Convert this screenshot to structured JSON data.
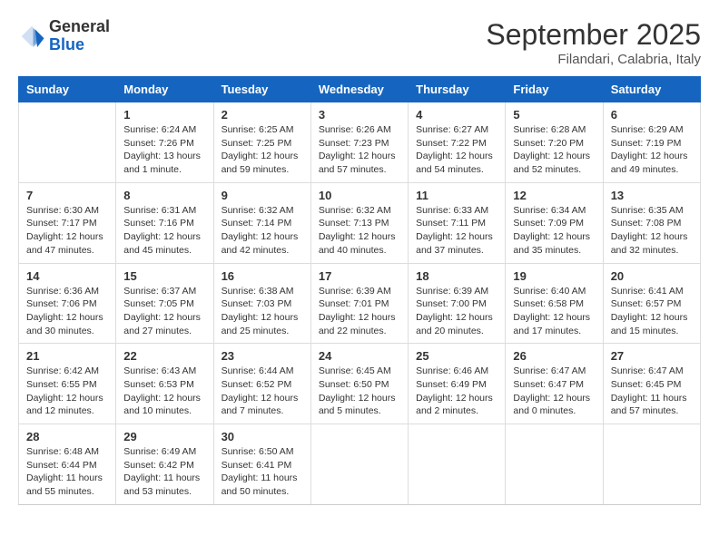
{
  "header": {
    "logo": {
      "general": "General",
      "blue": "Blue"
    },
    "title": "September 2025",
    "location": "Filandari, Calabria, Italy"
  },
  "days_of_week": [
    "Sunday",
    "Monday",
    "Tuesday",
    "Wednesday",
    "Thursday",
    "Friday",
    "Saturday"
  ],
  "weeks": [
    [
      {
        "day": "",
        "content": ""
      },
      {
        "day": "1",
        "content": "Sunrise: 6:24 AM\nSunset: 7:26 PM\nDaylight: 13 hours\nand 1 minute."
      },
      {
        "day": "2",
        "content": "Sunrise: 6:25 AM\nSunset: 7:25 PM\nDaylight: 12 hours\nand 59 minutes."
      },
      {
        "day": "3",
        "content": "Sunrise: 6:26 AM\nSunset: 7:23 PM\nDaylight: 12 hours\nand 57 minutes."
      },
      {
        "day": "4",
        "content": "Sunrise: 6:27 AM\nSunset: 7:22 PM\nDaylight: 12 hours\nand 54 minutes."
      },
      {
        "day": "5",
        "content": "Sunrise: 6:28 AM\nSunset: 7:20 PM\nDaylight: 12 hours\nand 52 minutes."
      },
      {
        "day": "6",
        "content": "Sunrise: 6:29 AM\nSunset: 7:19 PM\nDaylight: 12 hours\nand 49 minutes."
      }
    ],
    [
      {
        "day": "7",
        "content": "Sunrise: 6:30 AM\nSunset: 7:17 PM\nDaylight: 12 hours\nand 47 minutes."
      },
      {
        "day": "8",
        "content": "Sunrise: 6:31 AM\nSunset: 7:16 PM\nDaylight: 12 hours\nand 45 minutes."
      },
      {
        "day": "9",
        "content": "Sunrise: 6:32 AM\nSunset: 7:14 PM\nDaylight: 12 hours\nand 42 minutes."
      },
      {
        "day": "10",
        "content": "Sunrise: 6:32 AM\nSunset: 7:13 PM\nDaylight: 12 hours\nand 40 minutes."
      },
      {
        "day": "11",
        "content": "Sunrise: 6:33 AM\nSunset: 7:11 PM\nDaylight: 12 hours\nand 37 minutes."
      },
      {
        "day": "12",
        "content": "Sunrise: 6:34 AM\nSunset: 7:09 PM\nDaylight: 12 hours\nand 35 minutes."
      },
      {
        "day": "13",
        "content": "Sunrise: 6:35 AM\nSunset: 7:08 PM\nDaylight: 12 hours\nand 32 minutes."
      }
    ],
    [
      {
        "day": "14",
        "content": "Sunrise: 6:36 AM\nSunset: 7:06 PM\nDaylight: 12 hours\nand 30 minutes."
      },
      {
        "day": "15",
        "content": "Sunrise: 6:37 AM\nSunset: 7:05 PM\nDaylight: 12 hours\nand 27 minutes."
      },
      {
        "day": "16",
        "content": "Sunrise: 6:38 AM\nSunset: 7:03 PM\nDaylight: 12 hours\nand 25 minutes."
      },
      {
        "day": "17",
        "content": "Sunrise: 6:39 AM\nSunset: 7:01 PM\nDaylight: 12 hours\nand 22 minutes."
      },
      {
        "day": "18",
        "content": "Sunrise: 6:39 AM\nSunset: 7:00 PM\nDaylight: 12 hours\nand 20 minutes."
      },
      {
        "day": "19",
        "content": "Sunrise: 6:40 AM\nSunset: 6:58 PM\nDaylight: 12 hours\nand 17 minutes."
      },
      {
        "day": "20",
        "content": "Sunrise: 6:41 AM\nSunset: 6:57 PM\nDaylight: 12 hours\nand 15 minutes."
      }
    ],
    [
      {
        "day": "21",
        "content": "Sunrise: 6:42 AM\nSunset: 6:55 PM\nDaylight: 12 hours\nand 12 minutes."
      },
      {
        "day": "22",
        "content": "Sunrise: 6:43 AM\nSunset: 6:53 PM\nDaylight: 12 hours\nand 10 minutes."
      },
      {
        "day": "23",
        "content": "Sunrise: 6:44 AM\nSunset: 6:52 PM\nDaylight: 12 hours\nand 7 minutes."
      },
      {
        "day": "24",
        "content": "Sunrise: 6:45 AM\nSunset: 6:50 PM\nDaylight: 12 hours\nand 5 minutes."
      },
      {
        "day": "25",
        "content": "Sunrise: 6:46 AM\nSunset: 6:49 PM\nDaylight: 12 hours\nand 2 minutes."
      },
      {
        "day": "26",
        "content": "Sunrise: 6:47 AM\nSunset: 6:47 PM\nDaylight: 12 hours\nand 0 minutes."
      },
      {
        "day": "27",
        "content": "Sunrise: 6:47 AM\nSunset: 6:45 PM\nDaylight: 11 hours\nand 57 minutes."
      }
    ],
    [
      {
        "day": "28",
        "content": "Sunrise: 6:48 AM\nSunset: 6:44 PM\nDaylight: 11 hours\nand 55 minutes."
      },
      {
        "day": "29",
        "content": "Sunrise: 6:49 AM\nSunset: 6:42 PM\nDaylight: 11 hours\nand 53 minutes."
      },
      {
        "day": "30",
        "content": "Sunrise: 6:50 AM\nSunset: 6:41 PM\nDaylight: 11 hours\nand 50 minutes."
      },
      {
        "day": "",
        "content": ""
      },
      {
        "day": "",
        "content": ""
      },
      {
        "day": "",
        "content": ""
      },
      {
        "day": "",
        "content": ""
      }
    ]
  ]
}
